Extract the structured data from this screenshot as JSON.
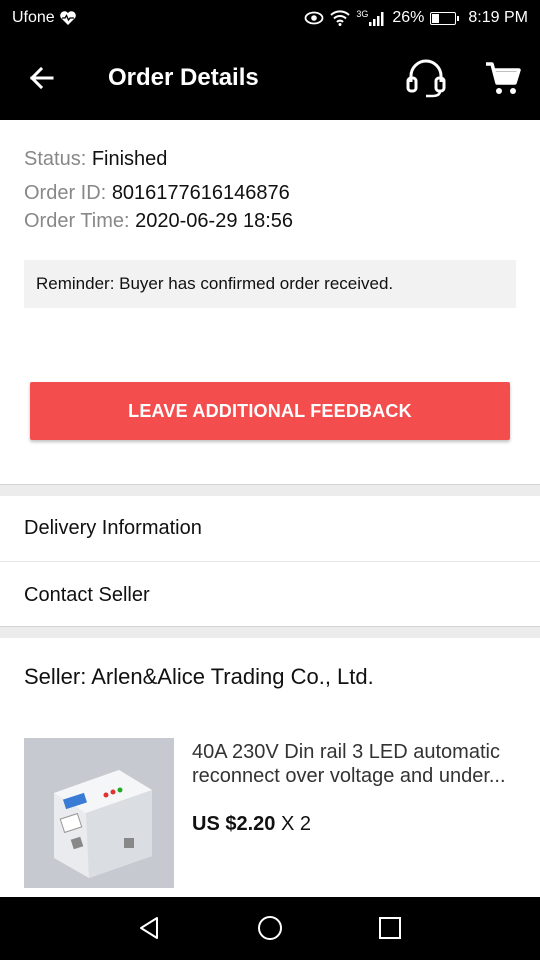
{
  "status_bar": {
    "carrier": "Ufone",
    "network_type": "3G",
    "battery": "26%",
    "time": "8:19 PM",
    "icons": [
      "heart-pulse-icon",
      "eye-icon",
      "wifi-icon",
      "signal-icon",
      "battery-icon"
    ]
  },
  "toolbar": {
    "title": "Order Details",
    "icons": [
      "back-arrow-icon",
      "headset-icon",
      "cart-icon"
    ]
  },
  "order": {
    "status_label": "Status:",
    "status_value": "Finished",
    "id_label": "Order ID:",
    "id_value": "8016177616146876",
    "time_label": "Order Time:",
    "time_value": "2020-06-29 18:56",
    "reminder": "Reminder: Buyer has confirmed order received."
  },
  "feedback_button": "LEAVE ADDITIONAL FEEDBACK",
  "sections": {
    "delivery": "Delivery Information",
    "contact": "Contact Seller"
  },
  "seller": "Seller: Arlen&Alice Trading Co., Ltd.",
  "product": {
    "title": "40A 230V Din rail 3 LED automatic reconnect over voltage and under...",
    "price": "US $2.20",
    "quantity": "X 2"
  },
  "colors": {
    "accent": "#f44d4d",
    "toolbar": "#000000"
  }
}
